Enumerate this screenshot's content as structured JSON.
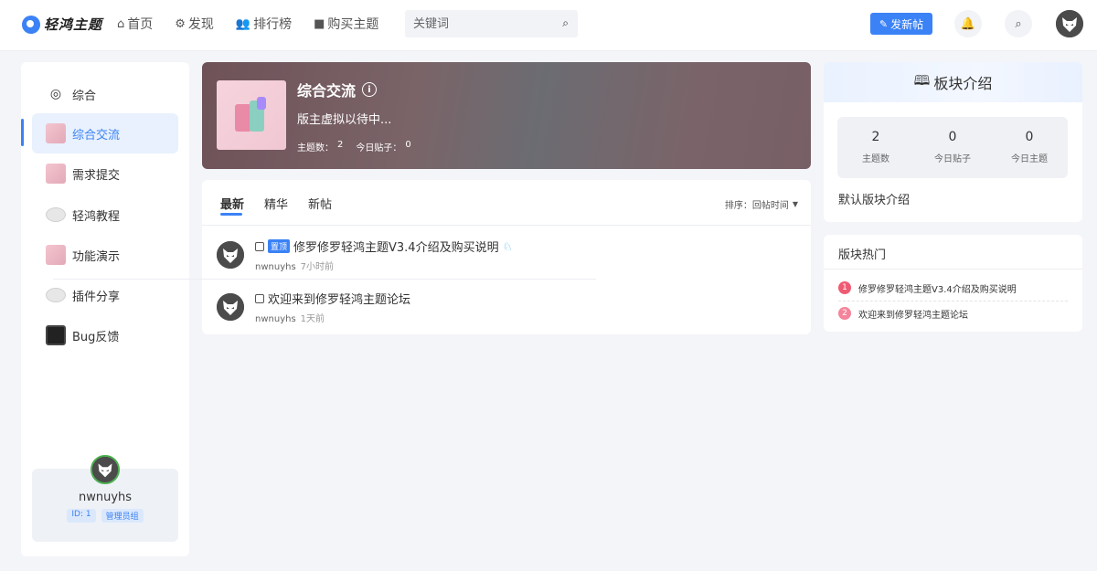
{
  "colors": {
    "accent": "#3b82f6",
    "page_bg": "#f4f5f8",
    "rank1": "#ef5b73",
    "rank2": "#f4849a"
  },
  "header": {
    "logo_text": "轻鸿主题",
    "nav": [
      {
        "label": "首页",
        "icon": "home-icon"
      },
      {
        "label": "发现",
        "icon": "compass-icon"
      },
      {
        "label": "排行榜",
        "icon": "users-icon"
      },
      {
        "label": "购买主题",
        "icon": "bag-icon"
      }
    ],
    "search_placeholder": "关键词",
    "post_button": "发新帖"
  },
  "sidebar": {
    "items": [
      {
        "label": "综合",
        "icon": "compass-icon"
      },
      {
        "label": "综合交流",
        "icon": "forum-thumb"
      },
      {
        "label": "需求提交",
        "icon": "forum-thumb"
      },
      {
        "label": "轻鸿教程",
        "icon": "speech-bubble-icon"
      },
      {
        "label": "功能演示",
        "icon": "forum-thumb"
      },
      {
        "label": "插件分享",
        "icon": "speech-bubble-icon"
      },
      {
        "label": "Bug反馈",
        "icon": "bug-thumb"
      }
    ],
    "user": {
      "name": "nwnuyhs",
      "id_tag": "ID: 1",
      "group_tag": "管理员组"
    }
  },
  "banner": {
    "title": "综合交流",
    "info_glyph": "i",
    "description": "版主虚拟以待中...",
    "topics_label": "主题数：",
    "topics_value": "2",
    "today_label": "今日贴子：",
    "today_value": "0"
  },
  "threads": {
    "tabs": [
      "最新",
      "精华",
      "新帖"
    ],
    "sort_label": "排序：回帖时间",
    "items": [
      {
        "pinned_label": "置顶",
        "title": "修罗修罗轻鸿主题V3.4介绍及购买说明",
        "author": "nwnuyhs",
        "time": "7小时前"
      },
      {
        "title": "欢迎来到修罗轻鸿主题论坛",
        "author": "nwnuyhs",
        "time": "1天前"
      }
    ]
  },
  "intro": {
    "title": "板块介绍",
    "stats": [
      {
        "value": "2",
        "label": "主题数"
      },
      {
        "value": "0",
        "label": "今日贴子"
      },
      {
        "value": "0",
        "label": "今日主题"
      }
    ],
    "text": "默认版块介绍"
  },
  "hot": {
    "title": "版块热门",
    "items": [
      {
        "rank": "1",
        "title": "修罗修罗轻鸿主题V3.4介绍及购买说明"
      },
      {
        "rank": "2",
        "title": "欢迎来到修罗轻鸿主题论坛"
      }
    ]
  }
}
